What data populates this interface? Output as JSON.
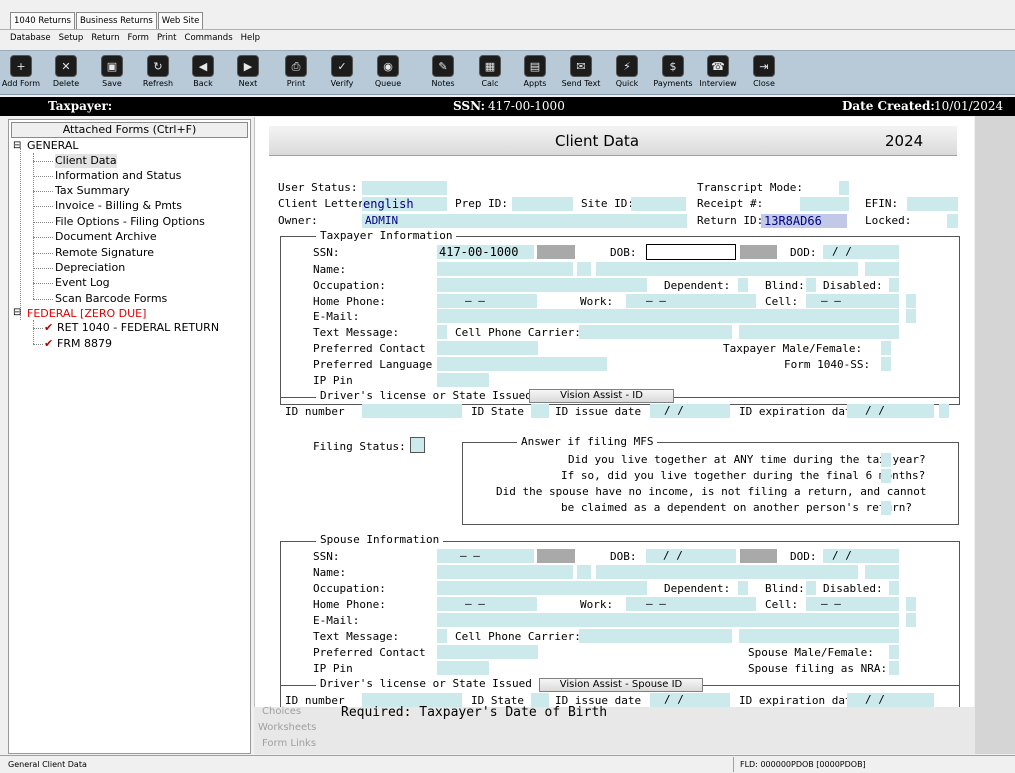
{
  "window_tabs": [
    "1040 Returns",
    "Business Returns",
    "Web Site"
  ],
  "menu": [
    "Database",
    "Setup",
    "Return",
    "Form",
    "Print",
    "Commands",
    "Help"
  ],
  "toolbar": [
    {
      "label": "Add Form",
      "icon": "add-form-icon",
      "glyph": "+"
    },
    {
      "label": "Delete",
      "icon": "delete-icon",
      "glyph": "✕"
    },
    {
      "label": "Save",
      "icon": "save-icon",
      "glyph": "▣"
    },
    {
      "label": "Refresh",
      "icon": "refresh-icon",
      "glyph": "↻"
    },
    {
      "label": "Back",
      "icon": "back-icon",
      "glyph": "◀"
    },
    {
      "label": "Next",
      "icon": "next-icon",
      "glyph": "▶"
    },
    {
      "label": "Print",
      "icon": "print-icon",
      "glyph": "⎙"
    },
    {
      "label": "Verify",
      "icon": "verify-icon",
      "glyph": "✓"
    },
    {
      "label": "Queue",
      "icon": "queue-icon",
      "glyph": "◉"
    },
    {
      "label": "Notes",
      "icon": "notes-icon",
      "glyph": "✎"
    },
    {
      "label": "Calc",
      "icon": "calculator-icon",
      "glyph": "▦"
    },
    {
      "label": "Appts",
      "icon": "calendar-icon",
      "glyph": "▤"
    },
    {
      "label": "Send Text",
      "icon": "send-text-icon",
      "glyph": "✉"
    },
    {
      "label": "Quick",
      "icon": "quick-icon",
      "glyph": "⚡"
    },
    {
      "label": "Payments",
      "icon": "payments-icon",
      "glyph": "$"
    },
    {
      "label": "Interview",
      "icon": "interview-icon",
      "glyph": "☎"
    },
    {
      "label": "Close",
      "icon": "close-icon",
      "glyph": "⇥"
    }
  ],
  "taxpayer_bar": {
    "taxpayer_label": "Taxpayer:",
    "ssn_label": "SSN:",
    "ssn": "417-00-1000",
    "date_label": "Date Created:",
    "date": "10/01/2024"
  },
  "tree": {
    "attached": "Attached Forms (Ctrl+F)",
    "general": "GENERAL",
    "items": [
      "Client Data",
      "Information and Status",
      "Tax Summary",
      "Invoice - Billing & Pmts",
      "File Options - Filing Options",
      "Document Archive",
      "Remote Signature",
      "Depreciation",
      "Event Log",
      "Scan Barcode Forms"
    ],
    "federal": "FEDERAL [ZERO DUE]",
    "fed_items": [
      "RET 1040 - FEDERAL RETURN",
      "FRM 8879"
    ],
    "expand_glyph": "⊟",
    "check_glyph": "✔"
  },
  "form": {
    "title": "Client Data",
    "year": "2024",
    "user_status": "User Status:",
    "client_letter": "Client Letter:",
    "client_letter_val": "english",
    "prep_id": "Prep ID:",
    "site_id": "Site ID:",
    "owner": "Owner:",
    "owner_val": "ADMIN",
    "transcript": "Transcript Mode:",
    "receipt": "Receipt #:",
    "efin": "EFIN:",
    "return_id": "Return ID:",
    "return_id_val": "13R8AD66",
    "locked": "Locked:",
    "tp_title": "Taxpayer Information",
    "ssn": "SSN:",
    "ssn_val": "417-00-1000",
    "dob": "DOB:",
    "dod": "DOD:",
    "name": "Name:",
    "occupation": "Occupation:",
    "dependent": "Dependent:",
    "blind": "Blind:",
    "disabled": "Disabled:",
    "home_phone": "Home Phone:",
    "work": "Work:",
    "cell": "Cell:",
    "email": "E-Mail:",
    "text_message": "Text Message:",
    "carrier": "Cell Phone Carrier:",
    "preferred_contact": "Preferred Contact",
    "tp_mf": "Taxpayer Male/Female:",
    "preferred_language": "Preferred Language",
    "form_1040ss": "Form 1040-SS:",
    "ip_pin": "IP Pin",
    "dl_title": "Driver's license or State Issued ID",
    "vision_id": "Vision Assist - ID",
    "id_number": "ID number",
    "id_state": "ID State",
    "id_issue": "ID issue date",
    "id_exp": "ID expiration date",
    "date_sep": "/   /",
    "phone_sep": "–   –",
    "filing_status": "Filing Status:",
    "mfs_title": "Answer if filing MFS",
    "mfs_q1": "Did you live together at ANY time during the tax year?",
    "mfs_q2": "If so, did you live together during the final 6 months?",
    "mfs_q3": "Did the spouse have no income, is not filing a return, and cannot",
    "mfs_q4": "be claimed as a dependent on another person's return?",
    "sp_title": "Spouse Information",
    "ssn_sep": "–   –",
    "sp_mf": "Spouse Male/Female:",
    "sp_nra": "Spouse filing as NRA:",
    "vision_sp": "Vision Assist - Spouse ID"
  },
  "bottom": {
    "choices": "Choices",
    "worksheets": "Worksheets",
    "form_links": "Form Links",
    "required": "Required: Taxpayer's Date of Birth"
  },
  "status": {
    "left": "General Client Data",
    "right": "FLD: 000000PDOB  [0000PDOB]"
  }
}
